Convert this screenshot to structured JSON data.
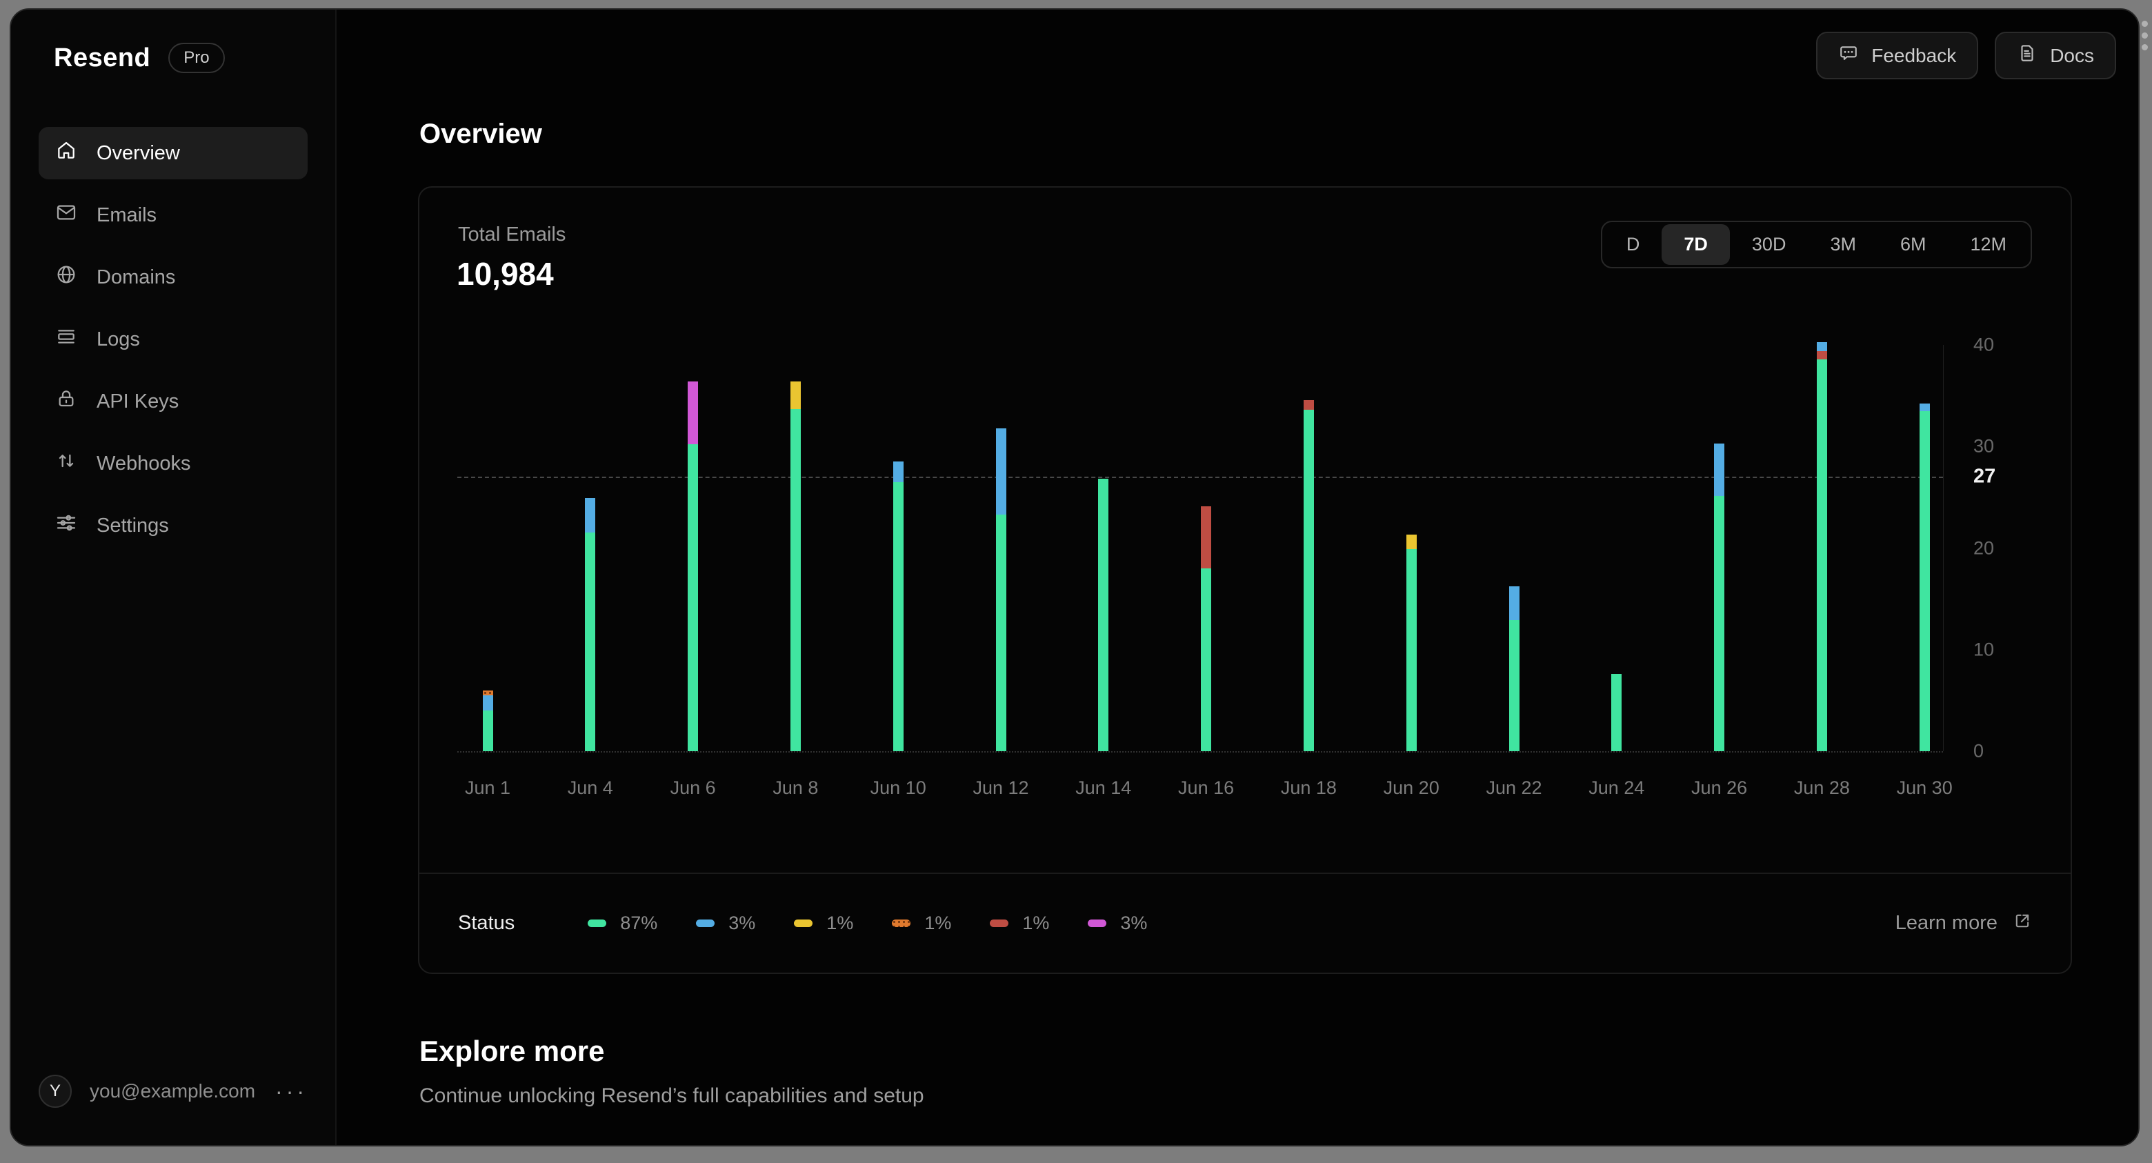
{
  "sidebar": {
    "logo": "Resend",
    "plan_badge": "Pro",
    "items": [
      {
        "label": "Overview",
        "icon": "home",
        "active": true
      },
      {
        "label": "Emails",
        "icon": "mail",
        "active": false
      },
      {
        "label": "Domains",
        "icon": "globe",
        "active": false
      },
      {
        "label": "Logs",
        "icon": "logs",
        "active": false
      },
      {
        "label": "API Keys",
        "icon": "lock",
        "active": false
      },
      {
        "label": "Webhooks",
        "icon": "webhooks",
        "active": false
      },
      {
        "label": "Settings",
        "icon": "settings",
        "active": false
      }
    ],
    "user": {
      "avatar_initial": "Y",
      "email": "you@example.com",
      "menu": "···"
    }
  },
  "header": {
    "buttons": [
      {
        "label": "Feedback",
        "icon": "feedback"
      },
      {
        "label": "Docs",
        "icon": "docs"
      }
    ]
  },
  "page": {
    "title": "Overview"
  },
  "card": {
    "metric_label": "Total Emails",
    "metric_value": "10,984",
    "ranges": [
      "D",
      "7D",
      "30D",
      "3M",
      "6M",
      "12M"
    ],
    "active_range": "7D",
    "status_label": "Status",
    "legend": [
      {
        "color": "#40e5a0",
        "percent": "87%",
        "pattern": "solid"
      },
      {
        "color": "#54ade4",
        "percent": "3%",
        "pattern": "solid"
      },
      {
        "color": "#eac531",
        "percent": "1%",
        "pattern": "solid"
      },
      {
        "color": "#e07a2e",
        "percent": "1%",
        "pattern": "dotted"
      },
      {
        "color": "#bf4d43",
        "percent": "1%",
        "pattern": "solid"
      },
      {
        "color": "#d158d6",
        "percent": "3%",
        "pattern": "solid"
      }
    ],
    "learn_more_label": "Learn more"
  },
  "chart_data": {
    "type": "bar",
    "stacked": true,
    "title": "Total Emails",
    "categories": [
      "Jun 1",
      "Jun 4",
      "Jun 6",
      "Jun 8",
      "Jun 10",
      "Jun 12",
      "Jun 14",
      "Jun 16",
      "Jun 18",
      "Jun 20",
      "Jun 22",
      "Jun 24",
      "Jun 26",
      "Jun 28",
      "Jun 30"
    ],
    "series": [
      {
        "name": "green",
        "color": "#40e5a0",
        "pattern": "solid",
        "values": [
          4.0,
          21.5,
          30.2,
          33.7,
          26.5,
          23.3,
          26.8,
          18.0,
          33.6,
          19.9,
          12.9,
          7.6,
          25.1,
          38.6,
          33.5
        ]
      },
      {
        "name": "red",
        "color": "#bf4d43",
        "pattern": "solid",
        "values": [
          0,
          0,
          0,
          0,
          0,
          0,
          0,
          6.1,
          1.0,
          0,
          0,
          0,
          0,
          0.8,
          0
        ]
      },
      {
        "name": "blue",
        "color": "#54ade4",
        "pattern": "solid",
        "values": [
          1.5,
          3.4,
          0,
          0,
          2.0,
          8.5,
          0,
          0,
          0,
          0,
          3.3,
          0,
          5.2,
          0.9,
          0.7
        ]
      },
      {
        "name": "yellow",
        "color": "#eac531",
        "pattern": "solid",
        "values": [
          0,
          0,
          0,
          2.7,
          0,
          0,
          0,
          0,
          0,
          1.4,
          0,
          0,
          0,
          0,
          0
        ]
      },
      {
        "name": "orange",
        "color": "#e07a2e",
        "pattern": "dotted",
        "values": [
          0.5,
          0,
          0,
          0,
          0,
          0,
          0,
          0,
          0,
          0,
          0,
          0,
          0,
          0,
          0
        ]
      },
      {
        "name": "magenta",
        "color": "#d158d6",
        "pattern": "solid",
        "values": [
          0,
          0,
          6.2,
          0,
          0,
          0,
          0,
          0,
          0,
          0,
          0,
          0,
          0,
          0,
          0
        ]
      }
    ],
    "ylim": [
      0,
      40
    ],
    "yticks": [
      0,
      10,
      20,
      30,
      40
    ],
    "avg_line": {
      "value": 27,
      "label": "27"
    },
    "grid": false,
    "legend_position": "bottom"
  },
  "explore": {
    "title": "Explore more",
    "subtitle": "Continue unlocking Resend’s full capabilities and setup"
  }
}
